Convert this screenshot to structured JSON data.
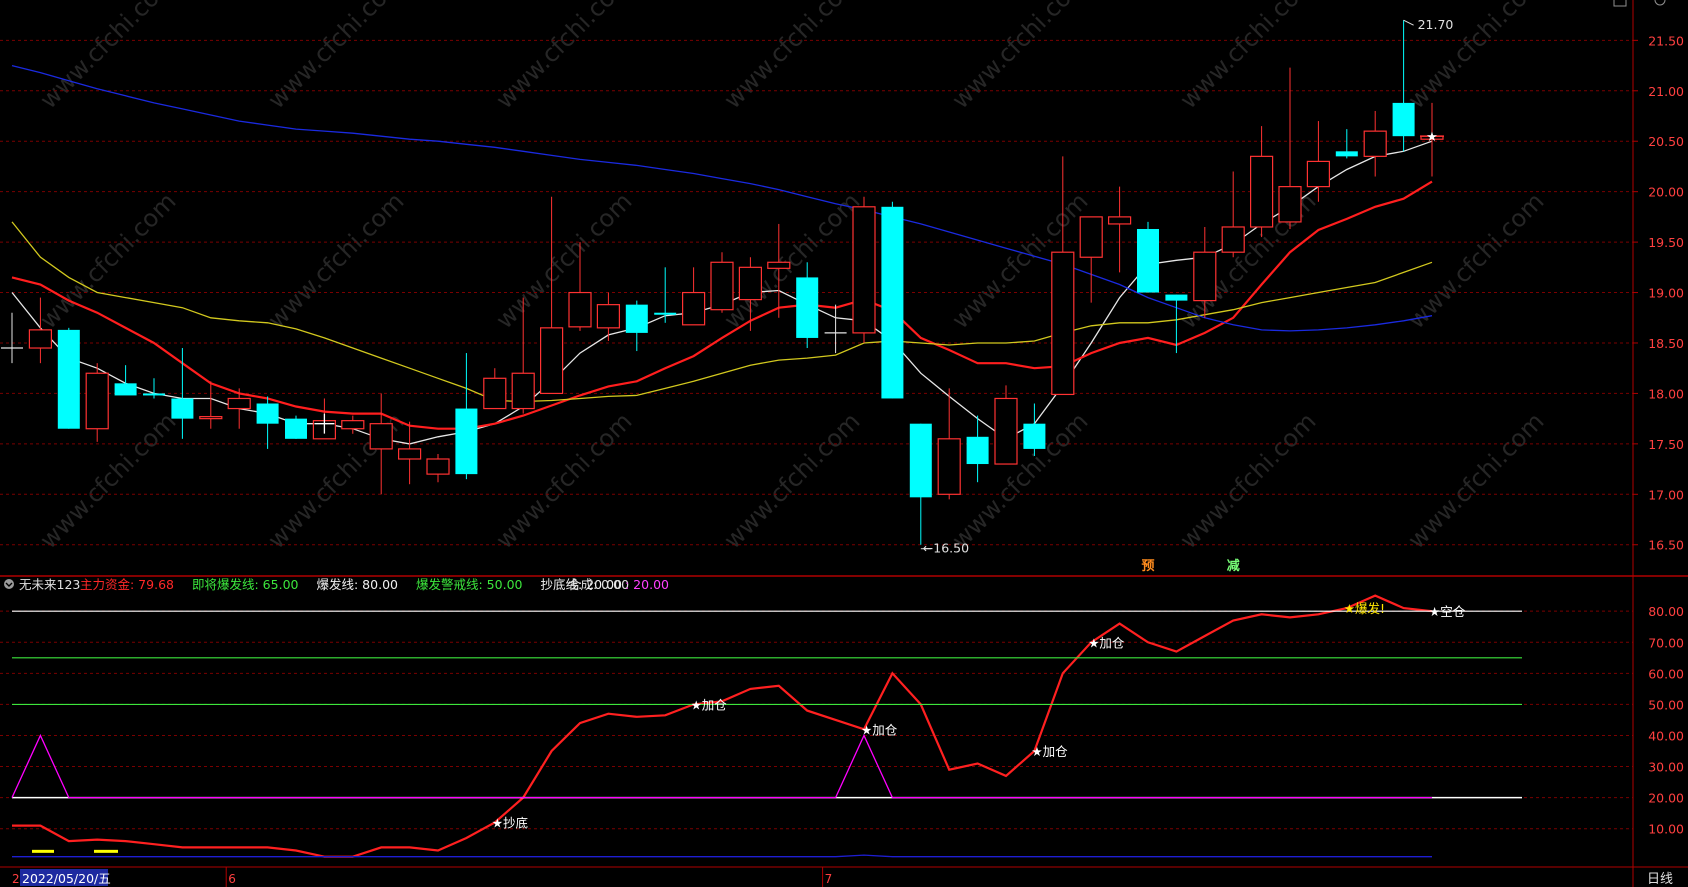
{
  "colors": {
    "up": "#ff3232",
    "down": "#00ffff",
    "ma_white": "#e6e6e6",
    "ma_red": "#ff1e1e",
    "ma_yellow": "#d2c81e",
    "ma_blue": "#1a2ae0",
    "grid": "#7a0000",
    "axis_text": "#ff4040",
    "background": "#000000"
  },
  "main_chart": {
    "price_axis": {
      "ticks": [
        "21.50",
        "21.00",
        "20.50",
        "20.00",
        "19.50",
        "19.00",
        "18.50",
        "18.00",
        "17.50",
        "17.00",
        "16.50"
      ],
      "ylim": [
        16.2,
        21.9
      ]
    },
    "high_label": "21.70",
    "low_label": "16.50",
    "markers": [
      {
        "index": 40,
        "text": "预",
        "color": "#ff8c1e"
      },
      {
        "index": 43,
        "text": "减",
        "color": "#78ff78"
      }
    ]
  },
  "indicator": {
    "name": "无未来123",
    "items": [
      {
        "label": "主力资金:",
        "value": "79.68",
        "color": "#ff2828"
      },
      {
        "label": "即将爆发线:",
        "value": "65.00",
        "color": "#3ce63c"
      },
      {
        "label": "爆发线:",
        "value": "80.00",
        "color": "#f0f0f0"
      },
      {
        "label": "爆发警戒线:",
        "value": "50.00",
        "color": "#3ce63c"
      },
      {
        "label": "抄底线:",
        "value": "20.00",
        "color": "#f0f0f0"
      }
    ],
    "compose_label": "合成:",
    "compose_value1": "0.00",
    "compose_value2": ": 20.00",
    "axis_ticks": [
      "80.00",
      "70.00",
      "60.00",
      "50.00",
      "40.00",
      "30.00",
      "20.00",
      "10.00"
    ],
    "ylim": [
      -2,
      91
    ],
    "signals": [
      {
        "index": 17,
        "text": "★抄底",
        "color": "#ffffff"
      },
      {
        "index": 24,
        "text": "★加仓",
        "color": "#ffffff"
      },
      {
        "index": 30,
        "text": "★加仓",
        "color": "#ffffff"
      },
      {
        "index": 36,
        "text": "★加仓",
        "color": "#ffffff"
      },
      {
        "index": 38,
        "text": "★加仓",
        "color": "#ffffff"
      },
      {
        "index": 47,
        "text": "★爆发!",
        "color": "#ffe600"
      },
      {
        "index": 50,
        "text": "★空仓",
        "color": "#ffffff"
      }
    ]
  },
  "bottom_bar": {
    "date_label": "2022/05/20/五",
    "month_marks": [
      {
        "index": 8,
        "text": "6"
      },
      {
        "index": 29,
        "text": "7"
      }
    ],
    "left_mark": "2",
    "period_label": "日线"
  },
  "watermark": "www.cfchi.com",
  "chart_data": [
    {
      "type": "candlestick",
      "x": [
        0,
        1,
        2,
        3,
        4,
        5,
        6,
        7,
        8,
        9,
        10,
        11,
        12,
        13,
        14,
        15,
        16,
        17,
        18,
        19,
        20,
        21,
        22,
        23,
        24,
        25,
        26,
        27,
        28,
        29,
        30,
        31,
        32,
        33,
        34,
        35,
        36,
        37,
        38,
        39,
        40,
        41,
        42,
        43,
        44,
        45,
        46,
        47,
        48,
        49,
        50
      ],
      "open": [
        18.45,
        18.45,
        18.63,
        17.65,
        18.1,
        18.0,
        17.95,
        17.75,
        17.85,
        17.9,
        17.75,
        17.55,
        17.65,
        17.45,
        17.35,
        17.2,
        17.85,
        17.85,
        17.85,
        18.0,
        18.66,
        18.65,
        18.88,
        18.8,
        18.68,
        18.83,
        18.93,
        19.24,
        19.15,
        18.6,
        18.6,
        19.85,
        17.7,
        17.0,
        17.57,
        17.3,
        17.7,
        17.99,
        19.35,
        19.68,
        19.63,
        18.98,
        18.92,
        19.4,
        19.65,
        19.7,
        20.05,
        20.4,
        20.35,
        20.88,
        20.52
      ],
      "close": [
        18.45,
        18.63,
        17.65,
        18.2,
        17.98,
        17.98,
        17.75,
        17.77,
        17.95,
        17.7,
        17.55,
        17.73,
        17.73,
        17.7,
        17.45,
        17.35,
        17.2,
        18.15,
        18.2,
        18.65,
        19.0,
        18.88,
        18.6,
        18.78,
        19.0,
        19.3,
        19.25,
        19.3,
        18.55,
        18.6,
        19.85,
        17.95,
        16.97,
        17.55,
        17.3,
        17.95,
        17.45,
        19.4,
        19.75,
        19.75,
        19.0,
        18.92,
        19.4,
        19.65,
        20.35,
        20.05,
        20.3,
        20.35,
        20.6,
        20.55,
        20.55
      ],
      "high": [
        18.8,
        18.95,
        18.65,
        18.3,
        18.28,
        18.15,
        18.45,
        18.12,
        18.05,
        17.97,
        17.78,
        17.95,
        17.78,
        18.0,
        17.72,
        17.4,
        18.4,
        18.25,
        18.95,
        19.95,
        19.5,
        19.0,
        18.92,
        19.25,
        19.25,
        19.4,
        19.35,
        19.68,
        19.3,
        18.88,
        19.95,
        19.9,
        17.7,
        18.05,
        17.78,
        18.08,
        17.9,
        20.35,
        19.75,
        20.05,
        19.7,
        18.98,
        19.65,
        20.2,
        20.65,
        21.23,
        20.7,
        20.62,
        20.8,
        21.7,
        20.88
      ],
      "low": [
        18.3,
        18.3,
        17.65,
        17.52,
        18.05,
        17.95,
        17.55,
        17.65,
        17.65,
        17.45,
        17.55,
        17.7,
        17.6,
        17.0,
        17.1,
        17.12,
        17.15,
        17.95,
        17.8,
        18.05,
        18.62,
        18.52,
        18.42,
        18.7,
        18.68,
        18.8,
        18.62,
        18.75,
        18.45,
        18.4,
        18.5,
        17.95,
        16.5,
        16.95,
        17.12,
        17.35,
        17.38,
        18.95,
        18.9,
        19.2,
        19.15,
        18.4,
        18.75,
        19.35,
        19.55,
        19.63,
        19.9,
        20.33,
        20.15,
        20.4,
        20.15
      ]
    },
    {
      "type": "line",
      "x": [
        0,
        1,
        2,
        3,
        4,
        5,
        6,
        7,
        8,
        9,
        10,
        11,
        12,
        13,
        14,
        15,
        16,
        17,
        18,
        19,
        20,
        21,
        22,
        23,
        24,
        25,
        26,
        27,
        28,
        29,
        30,
        31,
        32,
        33,
        34,
        35,
        36,
        37,
        38,
        39,
        40,
        41,
        42,
        43,
        44,
        45,
        46,
        47,
        48,
        49,
        50
      ],
      "series": [
        {
          "color": "#e6e6e6",
          "values": [
            19.0,
            18.65,
            18.35,
            18.25,
            18.1,
            18.0,
            17.95,
            17.95,
            17.85,
            17.8,
            17.7,
            17.7,
            17.65,
            17.55,
            17.5,
            17.57,
            17.62,
            17.7,
            17.87,
            18.12,
            18.4,
            18.58,
            18.65,
            18.77,
            18.8,
            18.88,
            19.0,
            19.02,
            18.88,
            18.75,
            18.72,
            18.52,
            18.2,
            17.97,
            17.75,
            17.55,
            17.7,
            18.08,
            18.5,
            18.95,
            19.28,
            19.32,
            19.35,
            19.48,
            19.68,
            19.85,
            20.05,
            20.22,
            20.35,
            20.4,
            20.5
          ]
        },
        {
          "color": "#ff1e1e",
          "values": [
            19.15,
            19.08,
            18.92,
            18.8,
            18.65,
            18.5,
            18.3,
            18.1,
            18.0,
            17.95,
            17.87,
            17.82,
            17.8,
            17.8,
            17.68,
            17.65,
            17.65,
            17.7,
            17.78,
            17.88,
            17.98,
            18.07,
            18.12,
            18.25,
            18.37,
            18.55,
            18.72,
            18.85,
            18.88,
            18.85,
            18.93,
            18.82,
            18.55,
            18.43,
            18.3,
            18.3,
            18.25,
            18.27,
            18.4,
            18.5,
            18.55,
            18.48,
            18.6,
            18.75,
            19.08,
            19.4,
            19.62,
            19.73,
            19.85,
            19.93,
            20.1
          ]
        },
        {
          "color": "#d2c81e",
          "values": [
            19.7,
            19.35,
            19.15,
            19.0,
            18.95,
            18.9,
            18.85,
            18.75,
            18.72,
            18.7,
            18.64,
            18.55,
            18.45,
            18.35,
            18.25,
            18.15,
            18.05,
            17.93,
            17.92,
            17.93,
            17.95,
            17.97,
            17.98,
            18.05,
            18.12,
            18.2,
            18.28,
            18.33,
            18.35,
            18.38,
            18.5,
            18.52,
            18.5,
            18.48,
            18.5,
            18.5,
            18.52,
            18.6,
            18.67,
            18.7,
            18.7,
            18.73,
            18.78,
            18.83,
            18.9,
            18.95,
            19.0,
            19.05,
            19.1,
            19.2,
            19.3
          ]
        },
        {
          "color": "#1a2ae0",
          "values": [
            21.25,
            21.18,
            21.1,
            21.02,
            20.95,
            20.88,
            20.82,
            20.76,
            20.7,
            20.66,
            20.62,
            20.6,
            20.58,
            20.55,
            20.52,
            20.5,
            20.47,
            20.44,
            20.4,
            20.36,
            20.32,
            20.29,
            20.26,
            20.22,
            20.18,
            20.13,
            20.08,
            20.02,
            19.95,
            19.88,
            19.82,
            19.75,
            19.68,
            19.6,
            19.52,
            19.44,
            19.36,
            19.28,
            19.18,
            19.08,
            18.95,
            18.85,
            18.75,
            18.68,
            18.63,
            18.62,
            18.63,
            18.65,
            18.68,
            18.72,
            18.77
          ]
        }
      ]
    },
    {
      "type": "line",
      "ylim": [
        -2,
        91
      ],
      "x": [
        0,
        1,
        2,
        3,
        4,
        5,
        6,
        7,
        8,
        9,
        10,
        11,
        12,
        13,
        14,
        15,
        16,
        17,
        18,
        19,
        20,
        21,
        22,
        23,
        24,
        25,
        26,
        27,
        28,
        29,
        30,
        31,
        32,
        33,
        34,
        35,
        36,
        37,
        38,
        39,
        40,
        41,
        42,
        43,
        44,
        45,
        46,
        47,
        48,
        49,
        50
      ],
      "series": [
        {
          "color": "#ff2020",
          "values": [
            11,
            11,
            6,
            6.5,
            6,
            5,
            4,
            4,
            4,
            4,
            3,
            1,
            1,
            4,
            4,
            3,
            7,
            12,
            20,
            35,
            44,
            47,
            46,
            46.5,
            50,
            51,
            55,
            56,
            48,
            45,
            42,
            60,
            50,
            29,
            31,
            27,
            35,
            60,
            70,
            76,
            70,
            67,
            72,
            77,
            79,
            78,
            79,
            81,
            85,
            81,
            80
          ]
        },
        {
          "color": "#ffffff",
          "values": [
            80,
            80,
            80,
            80,
            80,
            80,
            80,
            80,
            80,
            80,
            80,
            80,
            80,
            80,
            80,
            80,
            80,
            80,
            80,
            80,
            80,
            80,
            80,
            80,
            80,
            80,
            80,
            80,
            80,
            80,
            80,
            80,
            80,
            80,
            80,
            80,
            80,
            80,
            80,
            80,
            80,
            80,
            80,
            80,
            80,
            80,
            80,
            80,
            80,
            80,
            80
          ]
        },
        {
          "color": "#3ce63c",
          "values": [
            65,
            65,
            65,
            65,
            65,
            65,
            65,
            65,
            65,
            65,
            65,
            65,
            65,
            65,
            65,
            65,
            65,
            65,
            65,
            65,
            65,
            65,
            65,
            65,
            65,
            65,
            65,
            65,
            65,
            65,
            65,
            65,
            65,
            65,
            65,
            65,
            65,
            65,
            65,
            65,
            65,
            65,
            65,
            65,
            65,
            65,
            65,
            65,
            65,
            65,
            65
          ]
        },
        {
          "color": "#3ce63c",
          "values": [
            50,
            50,
            50,
            50,
            50,
            50,
            50,
            50,
            50,
            50,
            50,
            50,
            50,
            50,
            50,
            50,
            50,
            50,
            50,
            50,
            50,
            50,
            50,
            50,
            50,
            50,
            50,
            50,
            50,
            50,
            50,
            50,
            50,
            50,
            50,
            50,
            50,
            50,
            50,
            50,
            50,
            50,
            50,
            50,
            50,
            50,
            50,
            50,
            50,
            50,
            50
          ]
        },
        {
          "color": "#ffffff",
          "values": [
            20,
            20,
            20,
            20,
            20,
            20,
            20,
            20,
            20,
            20,
            20,
            20,
            20,
            20,
            20,
            20,
            20,
            20,
            20,
            20,
            20,
            20,
            20,
            20,
            20,
            20,
            20,
            20,
            20,
            20,
            20,
            20,
            20,
            20,
            20,
            20,
            20,
            20,
            20,
            20,
            20,
            20,
            20,
            20,
            20,
            20,
            20,
            20,
            20,
            20,
            20
          ]
        },
        {
          "color": "#ff00ff",
          "values": [
            20,
            40,
            20,
            20,
            20,
            20,
            20,
            20,
            20,
            20,
            20,
            20,
            20,
            20,
            20,
            20,
            20,
            20,
            20,
            20,
            20,
            20,
            20,
            20,
            20,
            20,
            20,
            20,
            20,
            20,
            40,
            20,
            20,
            20,
            20,
            20,
            20,
            20,
            20,
            20,
            20,
            20,
            20,
            20,
            20,
            20,
            20,
            20,
            20,
            20,
            20
          ]
        },
        {
          "color": "#1e1ed2",
          "values": [
            1,
            1,
            1,
            1,
            1,
            1,
            1,
            1,
            1,
            1,
            1,
            1,
            1,
            1,
            1,
            1,
            1,
            1,
            1,
            1,
            1,
            1,
            1,
            1,
            1,
            1,
            1,
            1,
            1,
            1,
            1.5,
            1,
            1,
            1,
            1,
            1,
            1,
            1,
            1,
            1,
            1,
            1,
            1,
            1,
            1,
            1,
            1,
            1,
            1,
            1,
            1
          ]
        }
      ]
    }
  ]
}
